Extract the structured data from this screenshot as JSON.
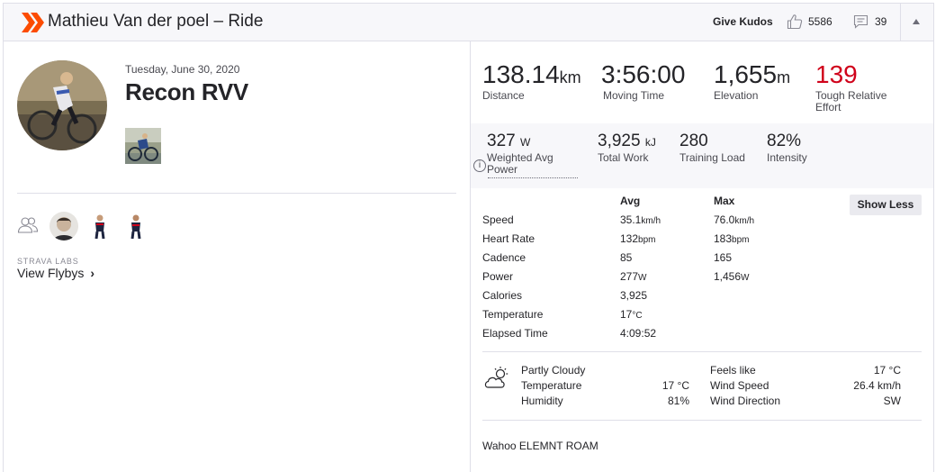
{
  "header": {
    "title": "Mathieu Van der poel – Ride",
    "give_kudos": "Give Kudos",
    "kudos_count": "5586",
    "comment_count": "39",
    "brand_color": "#fc4c02"
  },
  "activity": {
    "date": "Tuesday, June 30, 2020",
    "name": "Recon RVV"
  },
  "social": {
    "labs_label": "STRAVA LABS",
    "flyby_label": "View Flybys",
    "flyby_arrow": "›"
  },
  "primary_stats": [
    {
      "value": "138.14",
      "unit": "km",
      "label": "Distance"
    },
    {
      "value": "3:56:00",
      "unit": "",
      "label": "Moving Time"
    },
    {
      "value": "1,655",
      "unit": "m",
      "label": "Elevation"
    },
    {
      "value": "139",
      "unit": "",
      "label_line1": "Tough Relative",
      "label_line2": "Effort",
      "color": "#d0021b"
    }
  ],
  "secondary_stats": [
    {
      "value": "327",
      "unit": "W",
      "label_line1": "Weighted Avg",
      "label_line2": "Power"
    },
    {
      "value": "3,925",
      "unit": "kJ",
      "label": "Total Work"
    },
    {
      "value": "280",
      "unit": "",
      "label": "Training Load"
    },
    {
      "value": "82%",
      "unit": "",
      "label": "Intensity"
    }
  ],
  "info_glyph": "i",
  "details": {
    "avg_header": "Avg",
    "max_header": "Max",
    "show_less": "Show Less",
    "rows": [
      {
        "label": "Speed",
        "avg": "35.1",
        "avg_unit": "km/h",
        "max": "76.0",
        "max_unit": "km/h"
      },
      {
        "label": "Heart Rate",
        "avg": "132",
        "avg_unit": "bpm",
        "max": "183",
        "max_unit": "bpm"
      },
      {
        "label": "Cadence",
        "avg": "85",
        "avg_unit": "",
        "max": "165",
        "max_unit": ""
      },
      {
        "label": "Power",
        "avg": "277",
        "avg_unit": "W",
        "max": "1,456",
        "max_unit": "W"
      },
      {
        "label": "Calories",
        "avg": "3,925",
        "avg_unit": "",
        "max": "",
        "max_unit": ""
      },
      {
        "label": "Temperature",
        "avg": "17",
        "avg_unit": "°C",
        "max": "",
        "max_unit": ""
      },
      {
        "label": "Elapsed Time",
        "avg": "4:09:52",
        "avg_unit": "",
        "max": "",
        "max_unit": ""
      }
    ]
  },
  "weather": {
    "condition": "Partly Cloudy",
    "temperature_label": "Temperature",
    "temperature_value": "17 °C",
    "humidity_label": "Humidity",
    "humidity_value": "81%",
    "feels_like_label": "Feels like",
    "feels_like_value": "17 °C",
    "wind_speed_label": "Wind Speed",
    "wind_speed_value": "26.4 km/h",
    "wind_direction_label": "Wind Direction",
    "wind_direction_value": "SW"
  },
  "device": "Wahoo ELEMNT ROAM"
}
